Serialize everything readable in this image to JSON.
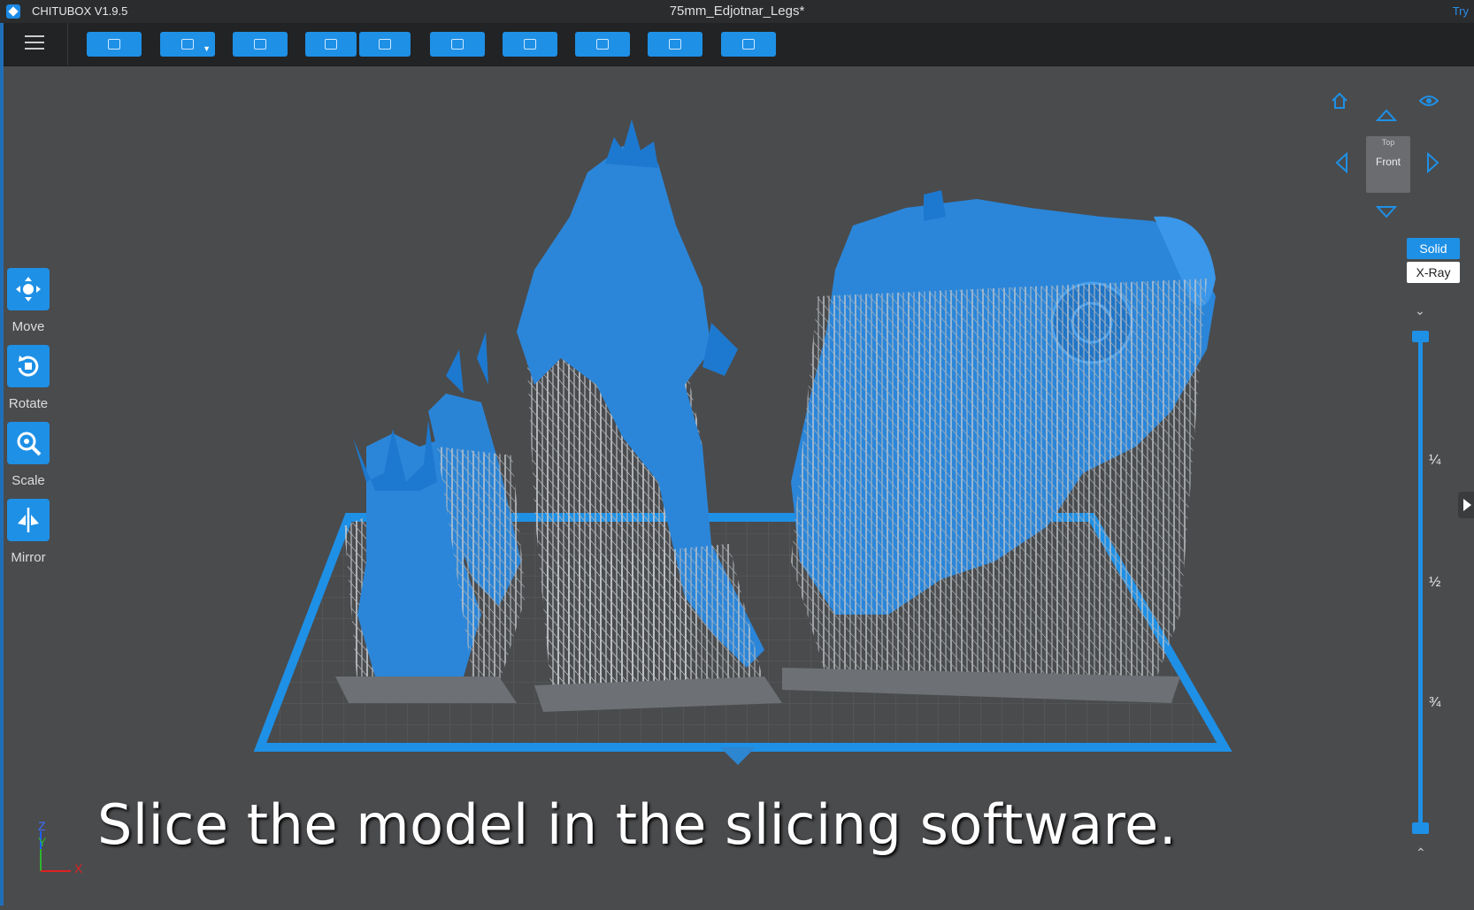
{
  "titlebar": {
    "app_title": "CHITUBOX V1.9.5",
    "file_title": "75mm_Edjotnar_Legs*",
    "try_label": "Try"
  },
  "toolbar": {
    "buttons": [
      {
        "name": "open-file",
        "icon": "folder-icon"
      },
      {
        "name": "save",
        "icon": "save-icon",
        "has_dropdown": true
      },
      {
        "name": "screenshot",
        "icon": "image-icon"
      },
      {
        "name": "undo",
        "icon": "undo-icon"
      },
      {
        "name": "redo",
        "icon": "redo-icon"
      },
      {
        "name": "settings",
        "icon": "settings-icon"
      },
      {
        "name": "auto-layout",
        "icon": "layout-icon"
      },
      {
        "name": "support",
        "icon": "support-icon"
      },
      {
        "name": "hollow",
        "icon": "hollow-icon"
      },
      {
        "name": "print",
        "icon": "print-icon"
      }
    ]
  },
  "tools": {
    "move": "Move",
    "rotate": "Rotate",
    "scale": "Scale",
    "mirror": "Mirror"
  },
  "navcube": {
    "top_label": "Top",
    "front_label": "Front"
  },
  "view_modes": {
    "solid": "Solid",
    "xray": "X-Ray",
    "active": "Solid"
  },
  "layer_slider": {
    "marks": [
      "¼",
      "½",
      "¾"
    ],
    "top_value": 0,
    "bottom_value": 1
  },
  "axis": {
    "z": "Z",
    "y": "Y",
    "x": "X"
  },
  "subtitle": "Slice the model in the slicing software.",
  "colors": {
    "accent": "#1e90e6",
    "model": "#2b86d9",
    "support": "#c9cdd2",
    "background": "#4a4b4d",
    "toolbar": "#222325"
  }
}
